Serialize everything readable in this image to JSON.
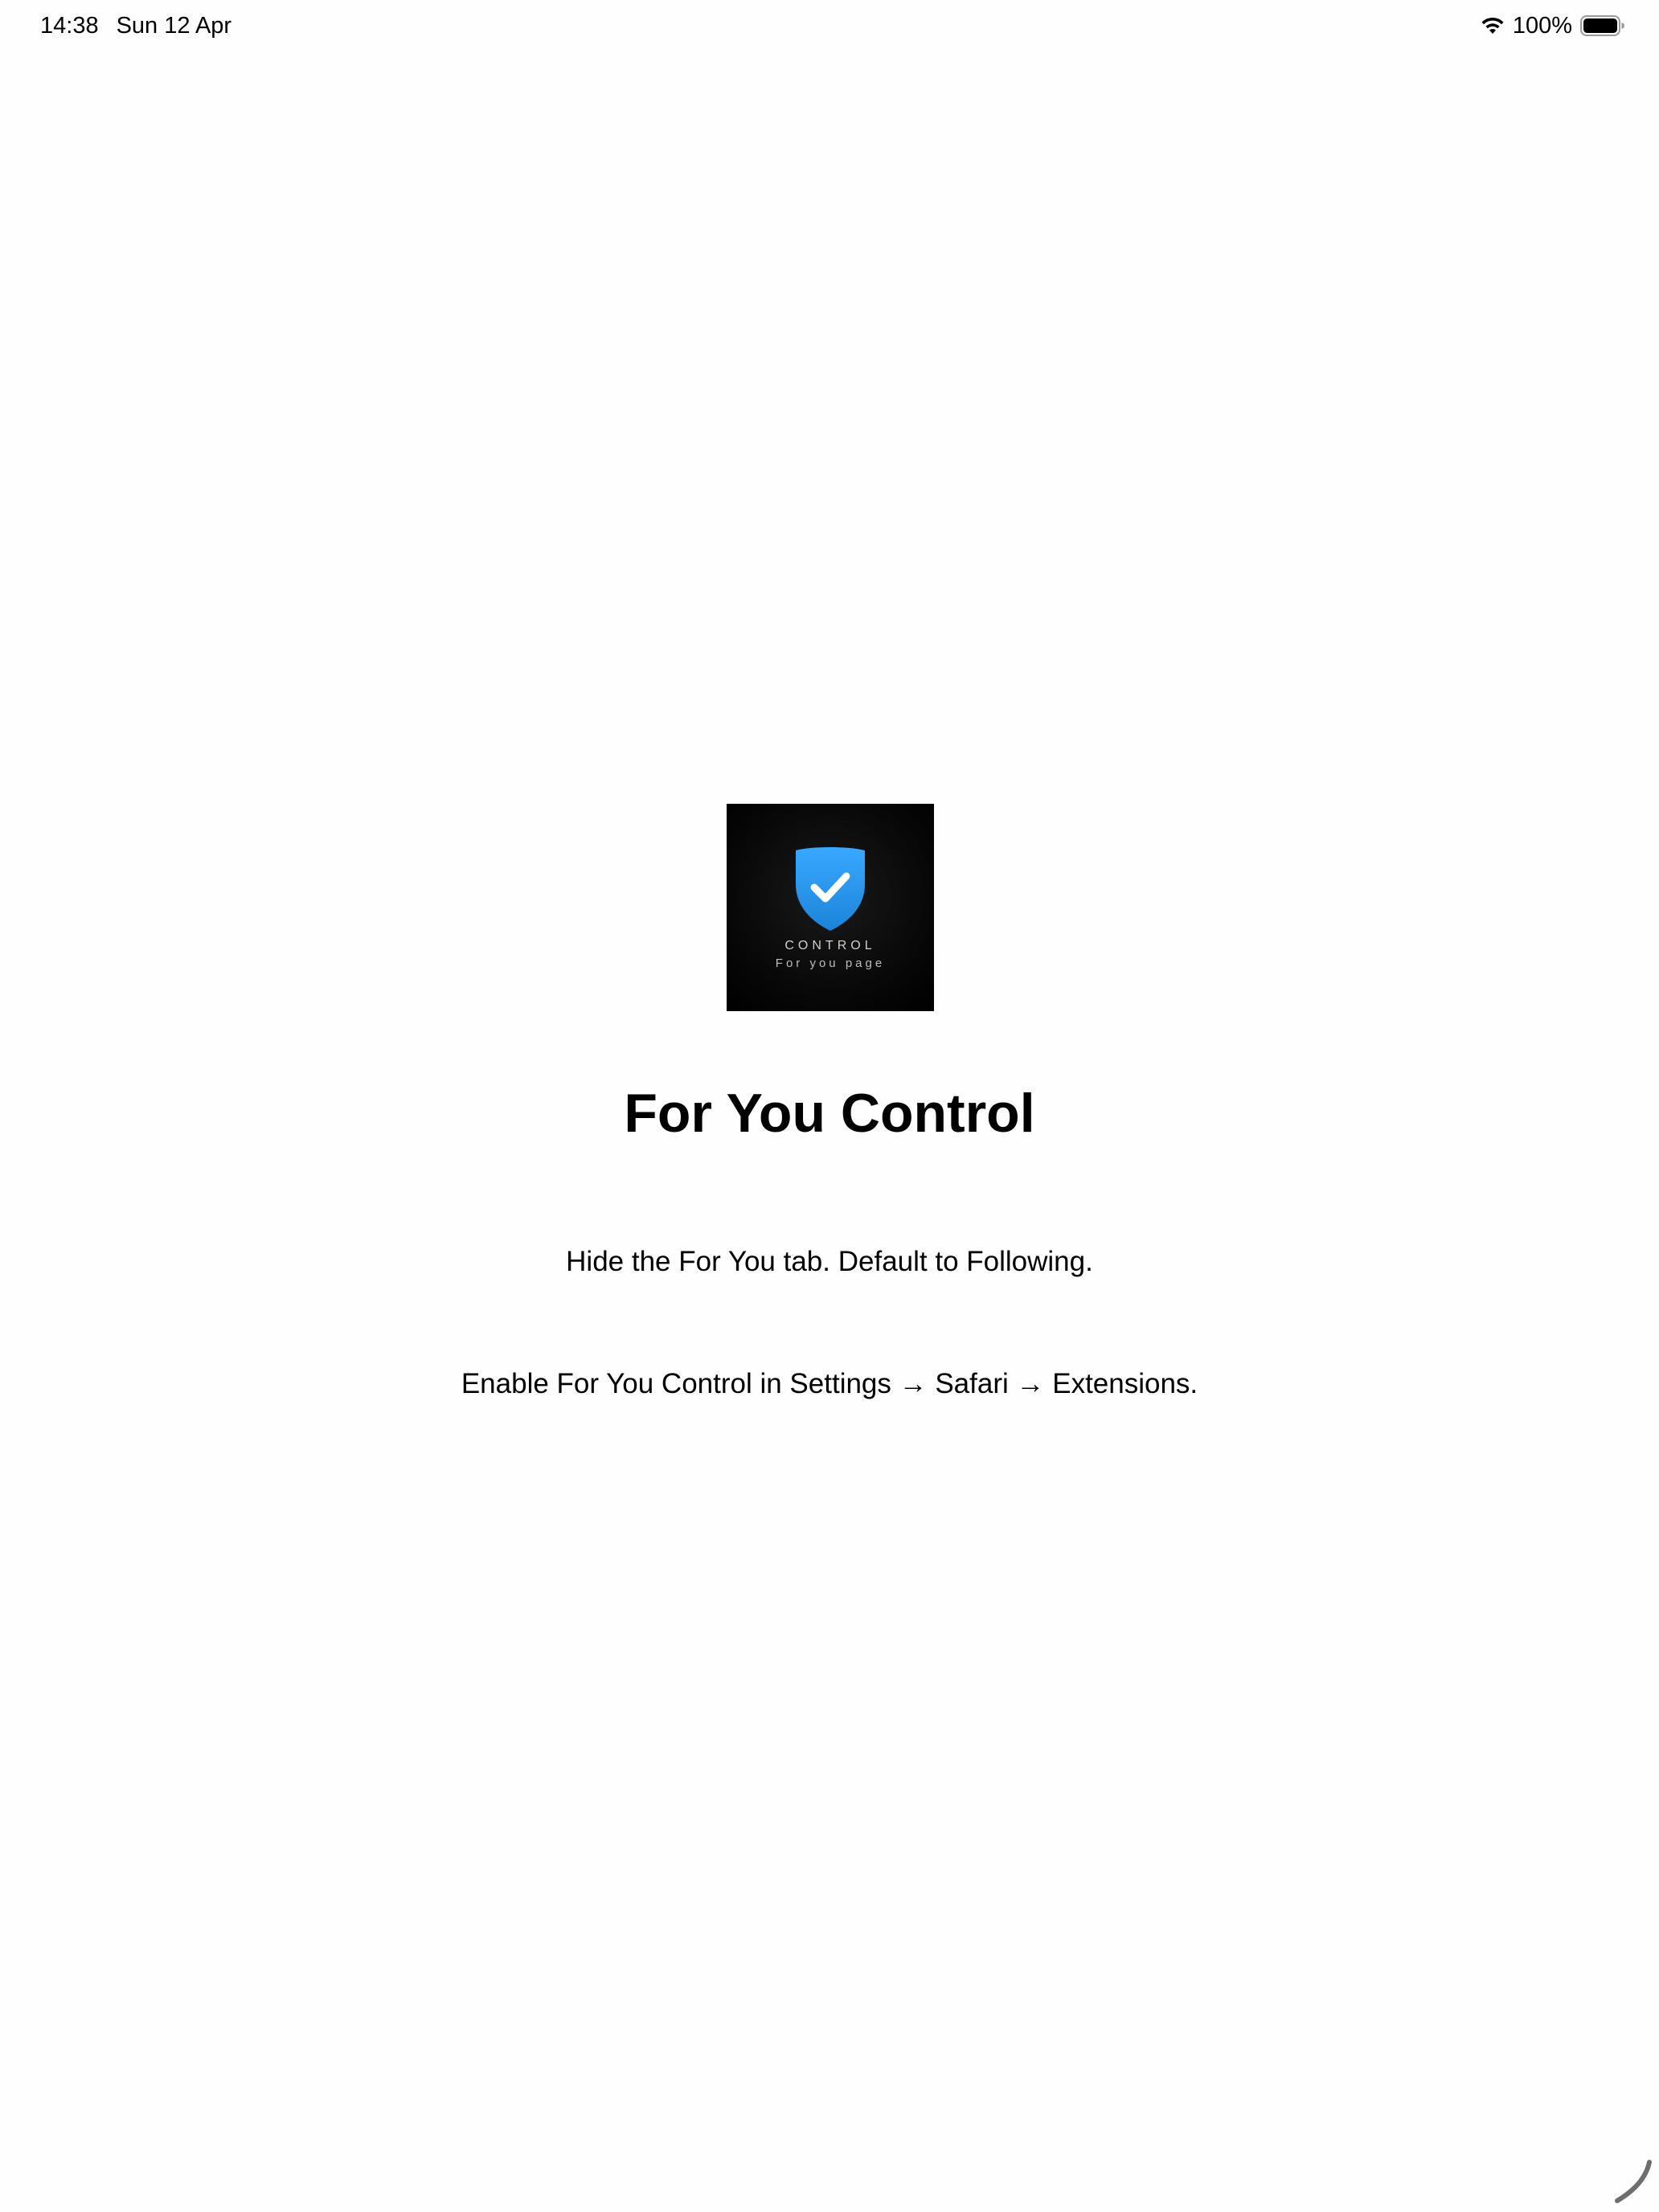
{
  "status_bar": {
    "time": "14:38",
    "date": "Sun 12 Apr",
    "battery_percent": "100%",
    "icons": [
      "wifi-icon",
      "battery-icon"
    ]
  },
  "app_icon": {
    "icon": "shield-check-icon",
    "text_line1": "CONTROL",
    "text_line2": "For you page",
    "accent_color": "#2b9af3",
    "background_color": "#000000"
  },
  "main": {
    "title": "For You Control",
    "tagline": "Hide the For You tab. Default to Following.",
    "instructions": "Enable For You Control in Settings → Safari → Extensions."
  }
}
